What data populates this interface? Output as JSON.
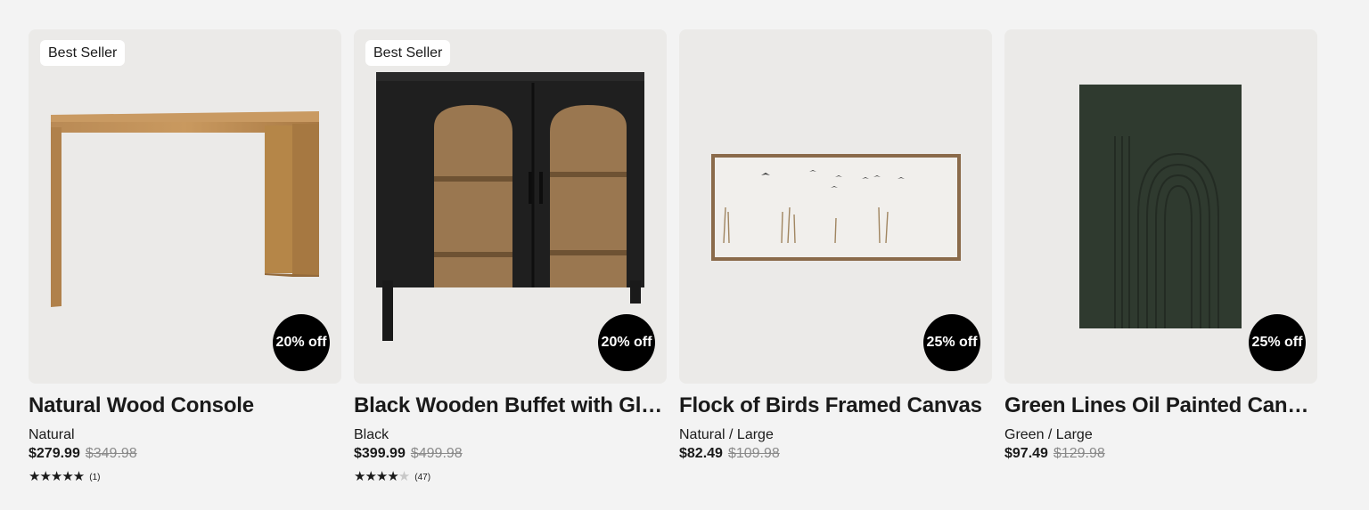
{
  "products": [
    {
      "best_seller": "Best Seller",
      "discount": "20% off",
      "title": "Natural Wood Console",
      "variant": "Natural",
      "price": "$279.99",
      "was_price": "$349.98",
      "rating_stars": "★★★★★",
      "rating_count": "(1)"
    },
    {
      "best_seller": "Best Seller",
      "discount": "20% off",
      "title": "Black Wooden Buffet with Glass Doors",
      "variant": "Black",
      "price": "$399.99",
      "was_price": "$499.98",
      "rating_stars": "★★★★",
      "rating_count": "(47)"
    },
    {
      "discount": "25% off",
      "title": "Flock of Birds Framed Canvas",
      "variant": "Natural / Large",
      "price": "$82.49",
      "was_price": "$109.98"
    },
    {
      "discount": "25% off",
      "title": "Green Lines Oil Painted Canvas",
      "variant": "Green / Large",
      "price": "$97.49",
      "was_price": "$129.98"
    }
  ]
}
